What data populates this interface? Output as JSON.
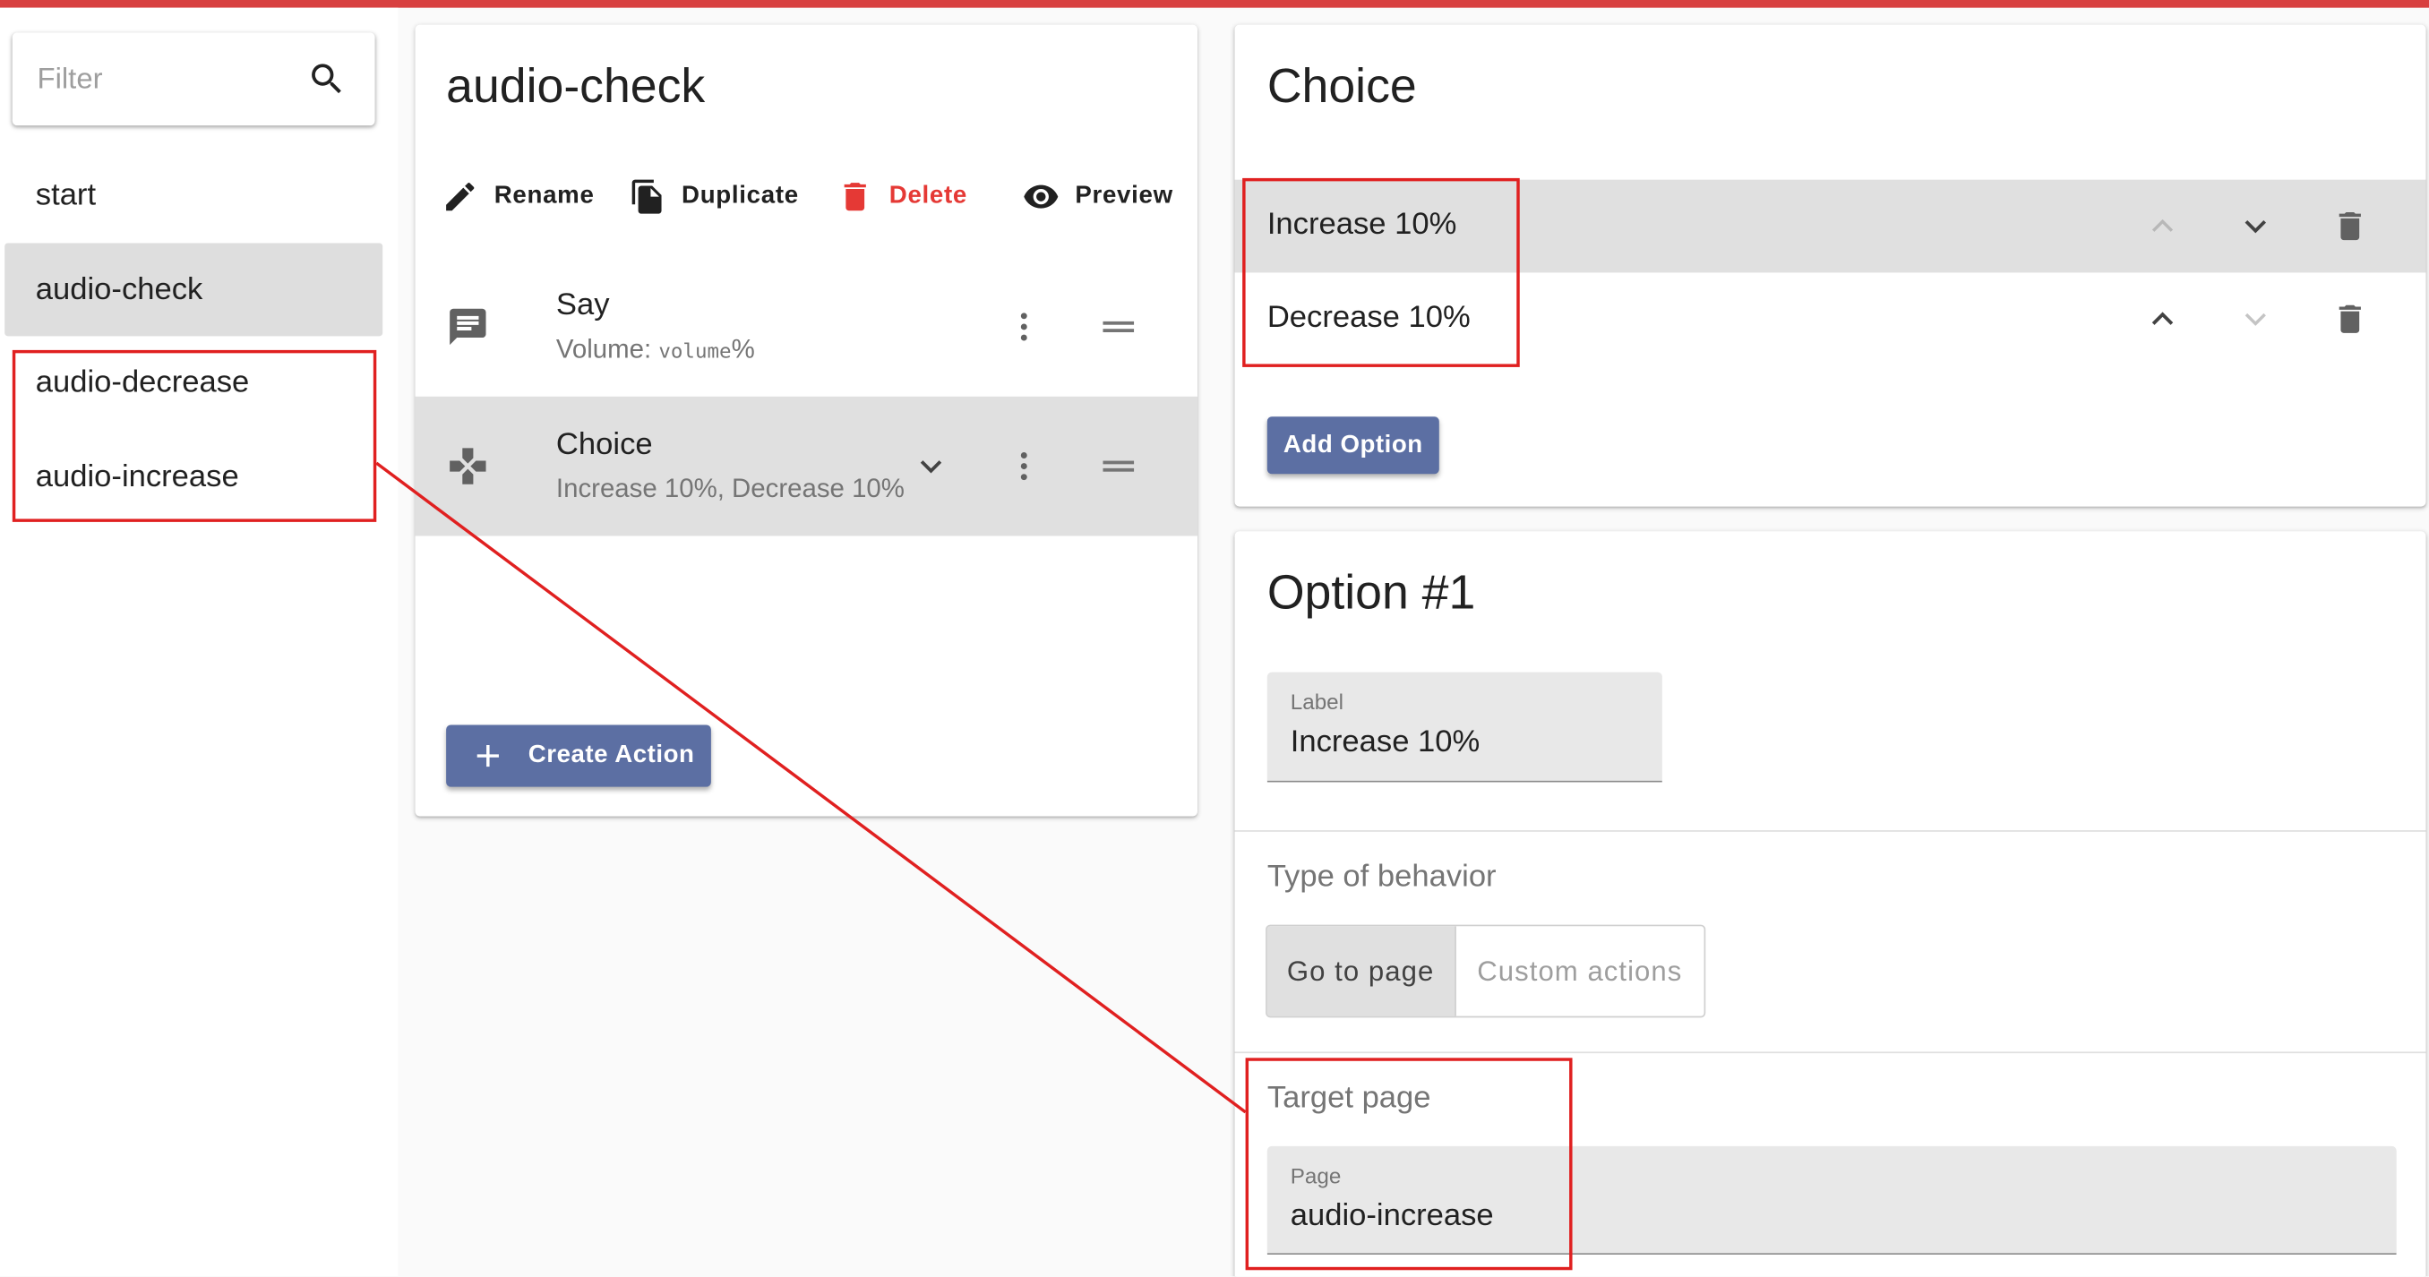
{
  "colors": {
    "accent": "#5c6fa3",
    "danger": "#e53935",
    "annotation": "#e02020",
    "top_bar": "#d84040",
    "selected_row": "#e0e0e0"
  },
  "sidebar": {
    "filter_placeholder": "Filter",
    "filter_icon": "search-icon",
    "pages": [
      {
        "label": "start",
        "active": false
      },
      {
        "label": "audio-check",
        "active": true
      },
      {
        "label": "audio-decrease",
        "active": false
      },
      {
        "label": "audio-increase",
        "active": false
      }
    ]
  },
  "page_editor": {
    "title": "audio-check",
    "toolbar": {
      "rename": "Rename",
      "duplicate": "Duplicate",
      "delete": "Delete",
      "preview": "Preview"
    },
    "actions": [
      {
        "icon": "message-icon",
        "title": "Say",
        "subtitle_prefix": "Volume: ",
        "subtitle_code": "volume",
        "subtitle_suffix": "%",
        "active": false
      },
      {
        "icon": "gamepad-icon",
        "title": "Choice",
        "subtitle": "Increase 10%, Decrease 10%",
        "active": true
      }
    ],
    "create_action": "Create Action"
  },
  "choice_editor": {
    "title": "Choice",
    "options": [
      {
        "label": "Increase 10%",
        "active": true
      },
      {
        "label": "Decrease 10%",
        "active": false
      }
    ],
    "add_option": "Add Option"
  },
  "option_editor": {
    "title": "Option #1",
    "label_field": {
      "label": "Label",
      "value": "Increase 10%"
    },
    "behavior_label": "Type of behavior",
    "behavior_options": [
      "Go to page",
      "Custom actions"
    ],
    "behavior_selected": "Go to page",
    "target_label": "Target page",
    "page_field": {
      "label": "Page",
      "value": "audio-increase"
    }
  }
}
